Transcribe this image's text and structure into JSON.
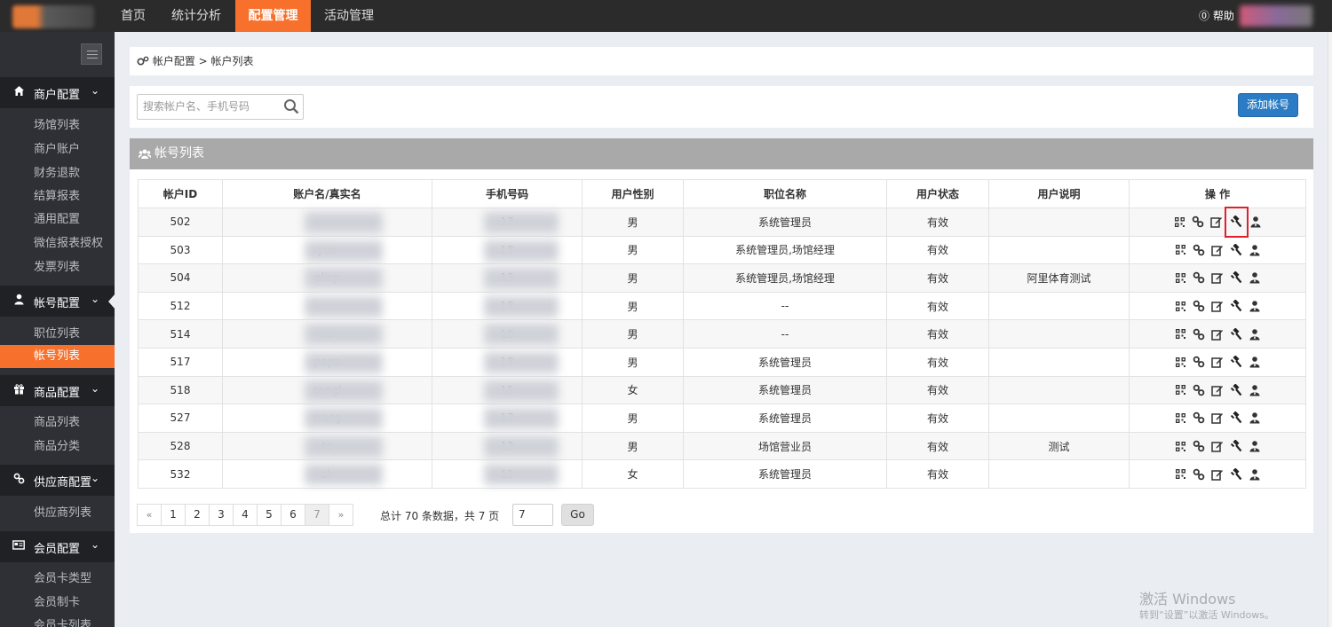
{
  "topnav": {
    "items": [
      {
        "label": "首页"
      },
      {
        "label": "统计分析"
      },
      {
        "label": "配置管理",
        "active": true
      },
      {
        "label": "活动管理"
      }
    ],
    "help": "帮助"
  },
  "sidebar": {
    "sections": [
      {
        "label": "商户配置",
        "icon": "home-icon",
        "items": [
          "场馆列表",
          "商户账户",
          "财务退款",
          "结算报表",
          "通用配置",
          "微信报表授权",
          "发票列表"
        ]
      },
      {
        "label": "帐号配置",
        "icon": "user-icon",
        "items": [
          "职位列表",
          "帐号列表"
        ],
        "active_item": "帐号列表"
      },
      {
        "label": "商品配置",
        "icon": "gift-icon",
        "items": [
          "商品列表",
          "商品分类"
        ]
      },
      {
        "label": "供应商配置",
        "icon": "link-icon",
        "items": [
          "供应商列表"
        ]
      },
      {
        "label": "会员配置",
        "icon": "card-icon",
        "items": [
          "会员卡类型",
          "会员制卡",
          "会员卡列表"
        ]
      }
    ]
  },
  "breadcrumb": {
    "text": "帐户配置 > 帐户列表"
  },
  "search": {
    "placeholder": "搜索帐户名、手机号码"
  },
  "add_button": "添加帐号",
  "list": {
    "title": "帐号列表",
    "columns": [
      "帐户ID",
      "账户名/真实名",
      "手机号码",
      "用户性别",
      "职位名称",
      "用户状态",
      "用户说明",
      "操 作"
    ],
    "rows": [
      {
        "id": "502",
        "name": "",
        "phone": "17",
        "gender": "男",
        "position": "系统管理员",
        "status": "有效",
        "note": ""
      },
      {
        "id": "503",
        "name": "yua",
        "phone": "18",
        "gender": "男",
        "position": "系统管理员,场馆经理",
        "status": "有效",
        "note": ""
      },
      {
        "id": "504",
        "name": "alisp",
        "phone": "13",
        "gender": "男",
        "position": "系统管理员,场馆经理",
        "status": "有效",
        "note": "阿里体育测试"
      },
      {
        "id": "512",
        "name": "",
        "phone": "18",
        "gender": "男",
        "position": "--",
        "status": "有效",
        "note": ""
      },
      {
        "id": "514",
        "name": "x",
        "phone": "18",
        "gender": "男",
        "position": "--",
        "status": "有效",
        "note": ""
      },
      {
        "id": "517",
        "name": "papa",
        "phone": "18",
        "gender": "男",
        "position": "系统管理员",
        "status": "有效",
        "note": ""
      },
      {
        "id": "518",
        "name": "songl",
        "phone": "15",
        "gender": "女",
        "position": "系统管理员",
        "status": "有效",
        "note": ""
      },
      {
        "id": "527",
        "name": "wang",
        "phone": "17",
        "gender": "男",
        "position": "系统管理员",
        "status": "有效",
        "note": ""
      },
      {
        "id": "528",
        "name": "te",
        "phone": "13",
        "gender": "男",
        "position": "场馆营业员",
        "status": "有效",
        "note": "测试"
      },
      {
        "id": "532",
        "name": "zh",
        "phone": "13",
        "gender": "女",
        "position": "系统管理员",
        "status": "有效",
        "note": ""
      }
    ]
  },
  "pagination": {
    "prev": "«",
    "pages": [
      "1",
      "2",
      "3",
      "4",
      "5",
      "6",
      "7"
    ],
    "current": "7",
    "next": "»",
    "total_text": "总计 70 条数据，共 7 页",
    "goto_value": "7",
    "go_label": "Go"
  },
  "watermark": {
    "line1": "激活 Windows",
    "line2": "转到“设置”以激活 Windows。"
  },
  "colors": {
    "accent": "#f7702c",
    "primary_button": "#2b7cc4",
    "sidebar": "#2e3035",
    "highlight_outline": "#e0202a"
  }
}
